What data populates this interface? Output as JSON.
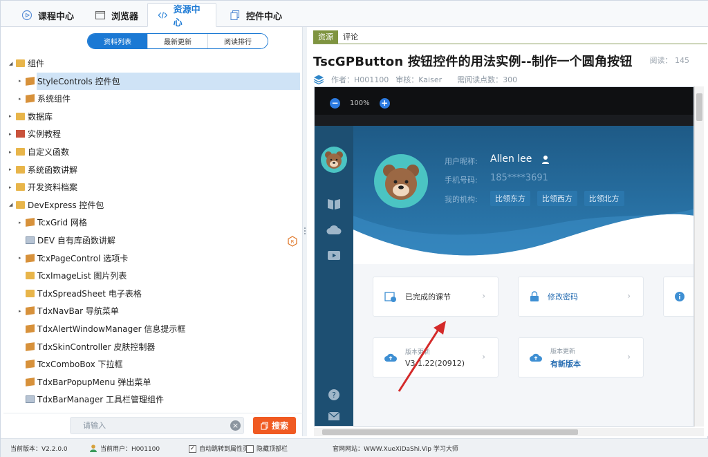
{
  "top_tabs": [
    {
      "label": "课程中心",
      "icon": "play-circle-icon"
    },
    {
      "label": "浏览器",
      "icon": "browser-window-icon"
    },
    {
      "label": "资源中心",
      "icon": "code-icon"
    },
    {
      "label": "控件中心",
      "icon": "copy-icon"
    }
  ],
  "left": {
    "segments": [
      "资料列表",
      "最新更新",
      "阅读排行"
    ],
    "tree": [
      {
        "label": "组件",
        "level": 0,
        "expanded": true,
        "icon": "folder-icon"
      },
      {
        "label": "StyleControls 控件包",
        "level": 1,
        "expanded": false,
        "icon": "package-icon",
        "selected": true
      },
      {
        "label": "系统组件",
        "level": 1,
        "expanded": false,
        "icon": "package-icon"
      },
      {
        "label": "数据库",
        "level": 0,
        "expanded": false,
        "icon": "folder-icon"
      },
      {
        "label": "实例教程",
        "level": 0,
        "expanded": false,
        "icon": "book-icon"
      },
      {
        "label": "自定义函数",
        "level": 0,
        "expanded": false,
        "icon": "folder-icon"
      },
      {
        "label": "系统函数讲解",
        "level": 0,
        "expanded": false,
        "icon": "folder-icon"
      },
      {
        "label": "开发资料档案",
        "level": 0,
        "expanded": false,
        "icon": "folder-icon"
      },
      {
        "label": "DevExpress 控件包",
        "level": 0,
        "expanded": true,
        "icon": "folder-icon"
      },
      {
        "label": "TcxGrid 网格",
        "level": 1,
        "expanded": false,
        "icon": "package-icon"
      },
      {
        "label": "DEV 自有库函数讲解",
        "level": 1,
        "icon": "document-icon"
      },
      {
        "label": "TcxPageControl 选项卡",
        "level": 1,
        "expanded": false,
        "icon": "package-icon"
      },
      {
        "label": "TcxImageList 图片列表",
        "level": 1,
        "icon": "folder-icon"
      },
      {
        "label": "TdxSpreadSheet 电子表格",
        "level": 1,
        "icon": "folder-icon"
      },
      {
        "label": "TdxNavBar 导航菜单",
        "level": 1,
        "expanded": false,
        "icon": "package-icon"
      },
      {
        "label": "TdxAlertWindowManager 信息提示框",
        "level": 1,
        "icon": "package-icon"
      },
      {
        "label": "TdxSkinController 皮肤控制器",
        "level": 1,
        "icon": "package-icon"
      },
      {
        "label": "TcxComboBox 下拉框",
        "level": 1,
        "icon": "package-icon"
      },
      {
        "label": "TdxBarPopupMenu 弹出菜单",
        "level": 1,
        "icon": "package-icon"
      },
      {
        "label": "TdxBarManager 工具栏管理组件",
        "level": 1,
        "icon": "document-icon"
      }
    ],
    "search_placeholder": "请输入",
    "search_button": "搜索"
  },
  "right": {
    "tabs": [
      "资源",
      "评论"
    ],
    "title": "TscGPButton 按钮控件的用法实例--制作一个圆角按钮",
    "reads_label": "阅读：",
    "reads_value": "145",
    "author_label": "作者：",
    "author": "H001100",
    "reviewer_label": "审核：",
    "reviewer": "Kaiser",
    "points_label": "需阅读点数：",
    "points": "300"
  },
  "inner_app": {
    "zoom_value": "100%",
    "nickname_label": "用户昵称:",
    "nickname": "Allen lee",
    "phone_label": "手机号码:",
    "phone": "185****3691",
    "org_label": "我的机构:",
    "orgs": [
      "比领东方",
      "比领西方",
      "比领北方"
    ],
    "cards": [
      {
        "label": "已完成的课节",
        "sub": ""
      },
      {
        "label": "修改密码",
        "sub": ""
      },
      {
        "label": "版本更新",
        "sub": "V3.1.22(20912)"
      },
      {
        "label": "版本更新",
        "sub": "有新版本"
      }
    ]
  },
  "status": {
    "version": "当前版本：V2.2.0.0",
    "user": "当前用户：H001100",
    "auto_jump": "自动跳转到属性页",
    "hide_top": "隐藏顶部栏",
    "website": "官网网站：WWW.XueXiDaShi.Vip  学习大师"
  },
  "colors": {
    "accent": "#1b79d4",
    "search": "#f05a22",
    "tab_green": "#7f9440"
  }
}
